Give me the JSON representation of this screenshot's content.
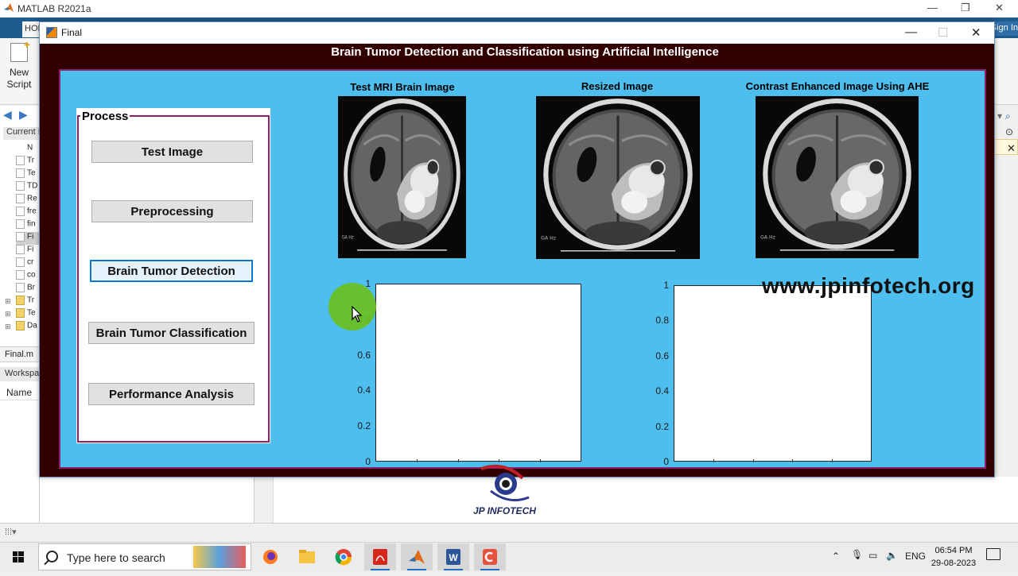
{
  "matlab": {
    "window_title": "MATLAB R2021a",
    "home_tab": "HOME",
    "sign_in": "Sign In",
    "new_script_line1": "New",
    "new_script_line2": "Script",
    "current_folder_label": "Current Folder",
    "files": [
      {
        "name": "N",
        "kind": "header"
      },
      {
        "name": "Tr",
        "kind": "file"
      },
      {
        "name": "Te",
        "kind": "file"
      },
      {
        "name": "TD",
        "kind": "file"
      },
      {
        "name": "Re",
        "kind": "file"
      },
      {
        "name": "fre",
        "kind": "file"
      },
      {
        "name": "fin",
        "kind": "file"
      },
      {
        "name": "Fi",
        "kind": "file",
        "selected": true
      },
      {
        "name": "Fi",
        "kind": "file"
      },
      {
        "name": "cr",
        "kind": "file"
      },
      {
        "name": "co",
        "kind": "file"
      },
      {
        "name": "Br",
        "kind": "file"
      },
      {
        "name": "Tr",
        "kind": "folder"
      },
      {
        "name": "Te",
        "kind": "folder"
      },
      {
        "name": "Da",
        "kind": "folder"
      }
    ],
    "editor_file": "Final.m",
    "workspace_label": "Workspace",
    "workspace_col": "Name"
  },
  "figure": {
    "window_title": "Final",
    "app_title": "Brain Tumor Detection and Classification using Artificial Intelligence",
    "process_label": "Process",
    "buttons": {
      "test_image": "Test Image",
      "preprocessing": "Preprocessing",
      "detection": "Brain Tumor Detection",
      "classification": "Brain Tumor Classification",
      "performance": "Performance Analysis"
    },
    "images": [
      {
        "title": "Test MRI Brain Image"
      },
      {
        "title": "Resized Image"
      },
      {
        "title": "Contrast Enhanced Image Using AHE"
      }
    ],
    "axes_ticks": [
      "1",
      "0.8",
      "0.6",
      "0.4",
      "0.2",
      "0"
    ]
  },
  "overlay": {
    "watermark": "www.jpinfotech.org",
    "logo_text": "JP INFOTECH"
  },
  "taskbar": {
    "search_placeholder": "Type here to search",
    "language": "ENG",
    "time": "06:54 PM",
    "date": "29-08-2023"
  },
  "colors": {
    "figure_bg": "#330000",
    "panel_bg": "#4dbeee",
    "panel_border": "#8b1f6e",
    "cursor_highlight": "#6abf1e"
  }
}
